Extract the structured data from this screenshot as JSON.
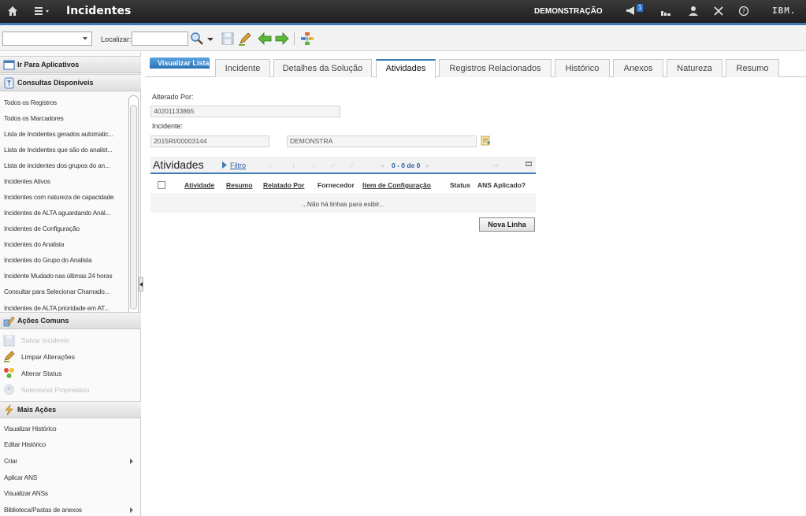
{
  "topbar": {
    "title": "Incidentes",
    "org": "DEMONSTRAÇÃO",
    "notification_count": "1",
    "brand": "IBM."
  },
  "toolbar": {
    "select_value": "",
    "find_label": "Localizar:",
    "find_value": ""
  },
  "sidebar": {
    "goto_apps": "Ir Para Aplicativos",
    "queries_head": "Consultas Disponíveis",
    "queries": [
      "Todos os Registros",
      "Todos os Marcadores",
      "Lista de Incidentes gerados automatic...",
      "Lista de Incidentes que são do analist...",
      "Lista de incidentes dos grupos do an...",
      "Incidentes Ativos",
      "Incidentes com natureza de capacidade",
      "Incidentes de ALTA aguardando Anál...",
      "Incidentes de Configuração",
      "Incidentes do Analista",
      "Incidentes do Grupo do Analista",
      "Incidente Mudado nas últimas 24 horas",
      "Consultar para Selecionar Chamado...",
      "Incidentes de ALTA prioridade em AT..."
    ],
    "common_head": "Ações Comuns",
    "common_actions": [
      {
        "label": "Salvar Incidente",
        "enabled": false
      },
      {
        "label": "Limpar Alterações",
        "enabled": true
      },
      {
        "label": "Alterar Status",
        "enabled": true
      },
      {
        "label": "Selecionar Proprietário",
        "enabled": false
      }
    ],
    "more_head": "Mais Ações",
    "more_actions": [
      "Visualizar Histórico",
      "Editar Histórico",
      "Criar",
      "Aplicar ANS",
      "Visualizar ANSs",
      "Biblioteca/Pastas de anexos"
    ]
  },
  "tabs": {
    "list_tab": "Visualizar Lista",
    "items": [
      "Incidente",
      "Detalhes da Solução",
      "Atividades",
      "Registros Relacionados",
      "Histórico",
      "Anexos",
      "Natureza",
      "Resumo"
    ],
    "active": "Atividades"
  },
  "form": {
    "changed_by_label": "Alterado Por:",
    "changed_by_value": "40201133865",
    "incident_label": "Incidente:",
    "incident_value": "2015RI/00003144",
    "incident_desc": "DEMONSTRA"
  },
  "activities": {
    "title": "Atividades",
    "filter_label": "Filtro",
    "count": "0 - 0 de 0",
    "columns": [
      "Atividade",
      "Resumo",
      "Relatado Por",
      "Fornecedor",
      "Item de Configuração",
      "Status",
      "ANS Aplicado?"
    ],
    "empty_text": "...Não há linhas para exibir...",
    "new_row_label": "Nova Linha"
  }
}
